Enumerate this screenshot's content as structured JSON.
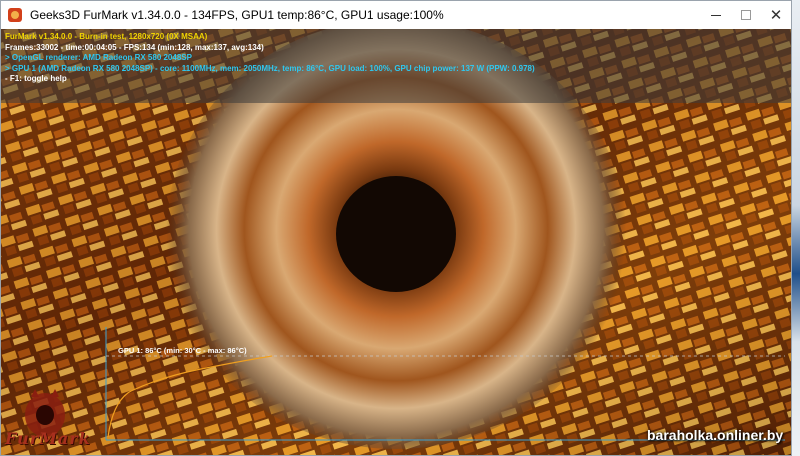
{
  "window": {
    "title": "Geeks3D FurMark v1.34.0.0 - 134FPS, GPU1 temp:86°C, GPU1 usage:100%",
    "icon": "furmark-app-icon",
    "controls": [
      "minimize",
      "maximize",
      "close"
    ],
    "close_glyph": "✕"
  },
  "osd": {
    "line1": "FurMark v1.34.0.0 - Burn-in test, 1280x720 (0X MSAA)",
    "line2": "Frames:33002 - time:00:04:05 - FPS:134 (min:128, max:137, avg:134)",
    "line3": "> OpenGL renderer: AMD Radeon RX 580 2048SP",
    "line4": "> GPU 1 (AMD Radeon RX 580 2048SP) - core: 1100MHz, mem: 2050MHz, temp: 86°C, GPU load: 100%, GPU chip power: 137 W (PPW: 0.978)",
    "line5": "- F1: toggle help"
  },
  "temp_graph": {
    "label": "GPU 1: 86°C (min: 30°C - max: 86°C)",
    "min": 30,
    "max": 86,
    "current": 86,
    "line_color": "#f0a020",
    "axis_color": "#3aa0d0"
  },
  "logo": {
    "text": "FurMark"
  },
  "watermark": "baraholka.onliner.by"
}
